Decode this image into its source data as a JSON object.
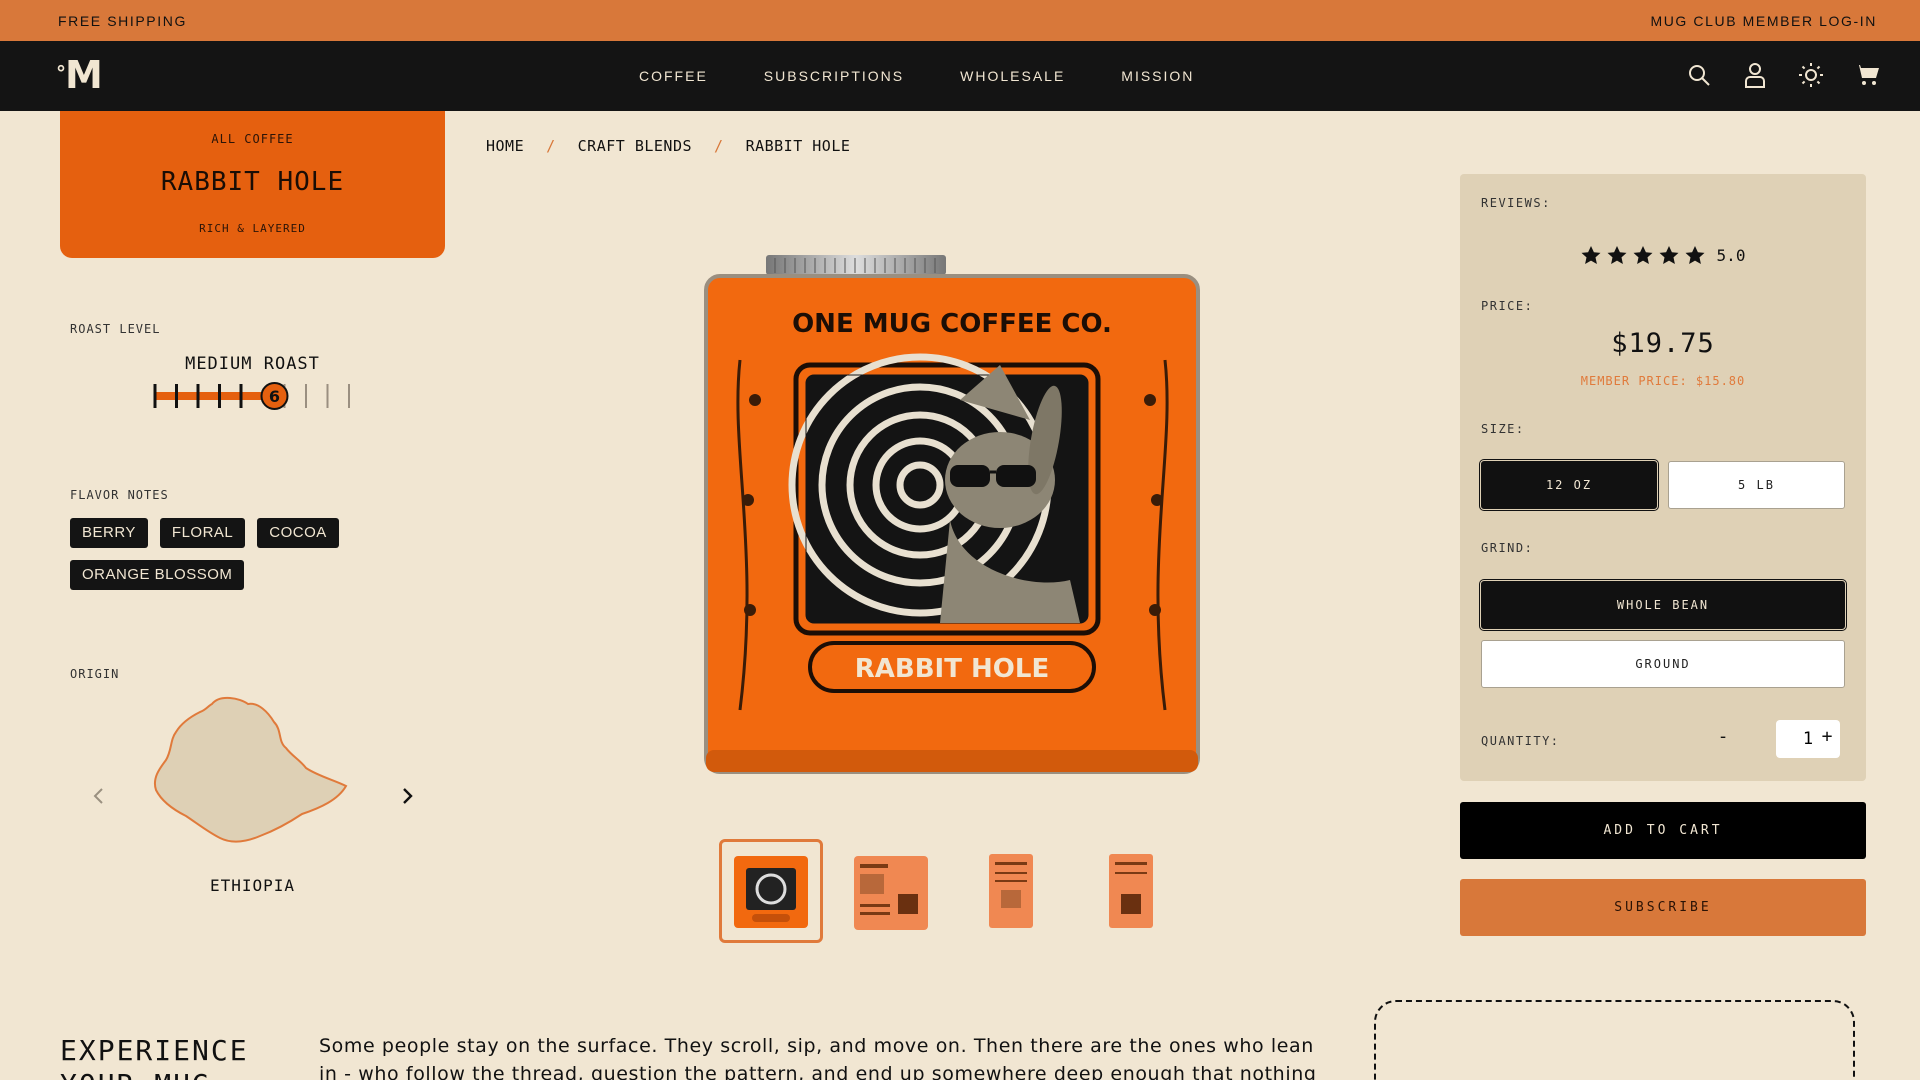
{
  "promo": {
    "left": "FREE SHIPPING",
    "right": "MUG CLUB MEMBER LOG-IN"
  },
  "nav": {
    "logo_symbol": "°",
    "logo_letter": "M",
    "links": [
      "COFFEE",
      "SUBSCRIPTIONS",
      "WHOLESALE",
      "MISSION"
    ],
    "icons": [
      "search-icon",
      "account-icon",
      "theme-toggle-icon",
      "cart-icon"
    ]
  },
  "product_card": {
    "category": "ALL COFFEE",
    "name": "RABBIT HOLE",
    "tagline": "RICH & LAYERED"
  },
  "roast": {
    "label": "ROAST LEVEL",
    "level_name": "MEDIUM ROAST",
    "level": 6,
    "max": 10
  },
  "flavor": {
    "label": "FLAVOR NOTES",
    "notes": [
      "BERRY",
      "FLORAL",
      "COCOA",
      "ORANGE BLOSSOM"
    ]
  },
  "origin": {
    "label": "ORIGIN",
    "country": "ETHIOPIA"
  },
  "breadcrumb": {
    "items": [
      "HOME",
      "CRAFT BLENDS",
      "RABBIT HOLE"
    ],
    "separator": "/"
  },
  "product_image": {
    "brand": "ONE MUG COFFEE CO.",
    "label": "RABBIT HOLE"
  },
  "thumbnails": {
    "count": 4,
    "active_index": 0
  },
  "purchase": {
    "reviews_label": "REVIEWS:",
    "rating": "5.0",
    "stars": 5,
    "price_label": "PRICE:",
    "price": "$19.75",
    "member_price": "MEMBER PRICE: $15.80",
    "size_label": "SIZE:",
    "sizes": [
      "12 OZ",
      "5 LB"
    ],
    "selected_size": "12 OZ",
    "grind_label": "GRIND:",
    "grinds": [
      "WHOLE BEAN",
      "GROUND"
    ],
    "selected_grind": "WHOLE BEAN",
    "quantity_label": "QUANTITY:",
    "quantity": "1",
    "minus": "-",
    "plus": "+",
    "add_to_cart": "ADD TO CART",
    "subscribe": "SUBSCRIBE"
  },
  "story": {
    "title_line1": "EXPERIENCE",
    "title_line2": "YOUR MUG",
    "text": "Some people stay on the surface. They scroll, sip, and move on. Then there are the ones who lean in - who follow the thread, question the pattern, and end up somewhere deep enough that nothing looks"
  },
  "colors": {
    "accent": "#d8783a",
    "card_orange": "#e5600f",
    "background": "#f1e6d2",
    "dark": "#141414",
    "panel": "#dfd1b6"
  }
}
